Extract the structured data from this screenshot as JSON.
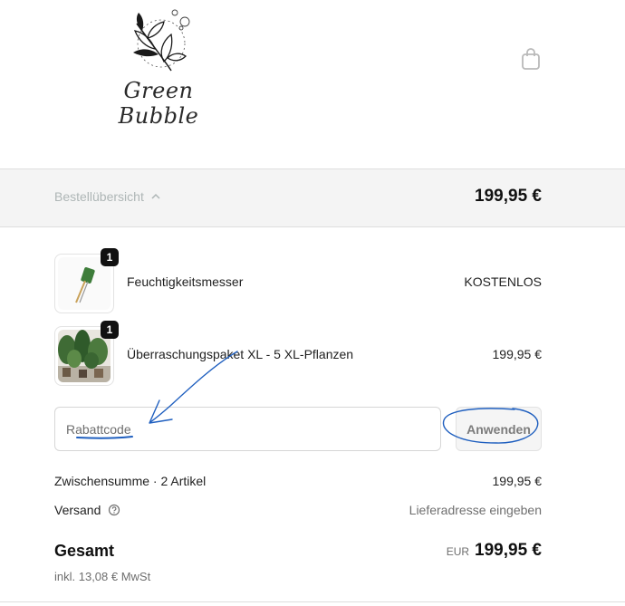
{
  "brand": {
    "name": "Green Bubble",
    "logo_icon": "plant-branch-logo"
  },
  "header": {
    "cart_icon": "shopping-bag-icon"
  },
  "summary": {
    "toggle_label": "Bestellübersicht",
    "toggle_icon": "chevron-up-icon",
    "total": "199,95 €"
  },
  "items": [
    {
      "quantity": "1",
      "name": "Feuchtigkeitsmesser",
      "price": "KOSTENLOS",
      "thumbnail": "moisture-meter-image"
    },
    {
      "quantity": "1",
      "name": "Überraschungspaket XL - 5 XL-Pflanzen",
      "price": "199,95 €",
      "thumbnail": "plants-package-image"
    }
  ],
  "discount": {
    "placeholder": "Rabattcode",
    "apply_label": "Anwenden"
  },
  "totals": {
    "subtotal_label": "Zwischensumme · 2 Artikel",
    "subtotal_value": "199,95 €",
    "shipping_label": "Versand",
    "shipping_info_icon": "question-circle-icon",
    "shipping_value": "Lieferadresse eingeben",
    "total_label": "Gesamt",
    "currency": "EUR",
    "total_value": "199,95 €",
    "tax_note": "inkl. 13,08 € MwSt"
  },
  "colors": {
    "annotation_blue": "#1f5fbf",
    "summary_bg": "#f4f4f4"
  }
}
